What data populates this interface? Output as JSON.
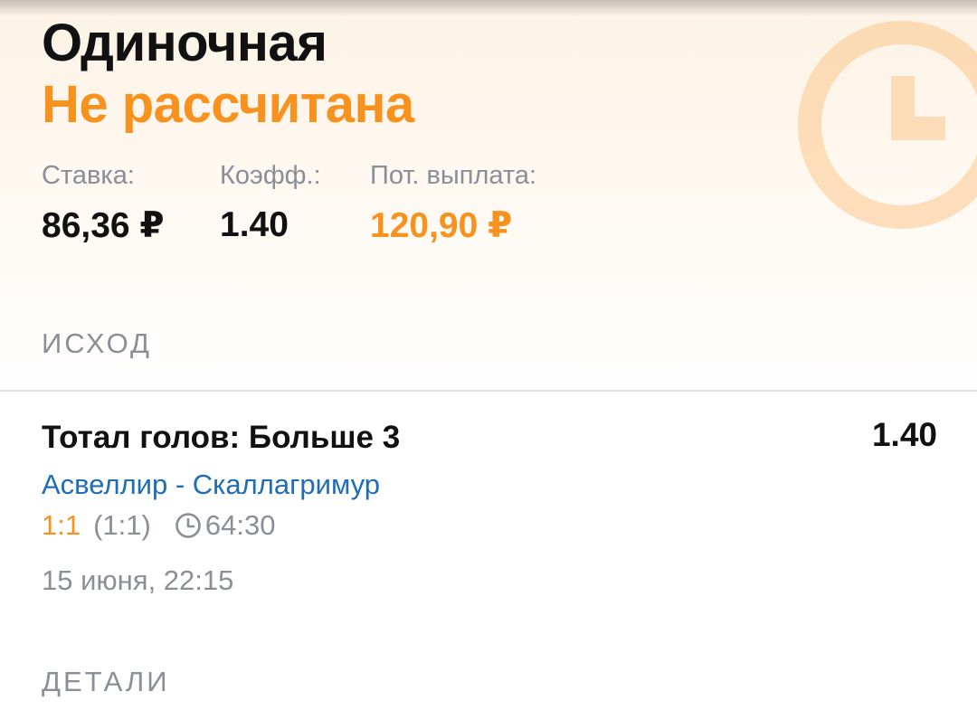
{
  "bet": {
    "type": "Одиночная",
    "status": "Не рассчитана",
    "stake_label": "Ставка:",
    "stake_value": "86,36 ₽",
    "coef_label": "Коэфф.:",
    "coef_value": "1.40",
    "payout_label": "Пот. выплата:",
    "payout_value": "120,90 ₽"
  },
  "sections": {
    "outcome_title": "ИСХОД",
    "details_title": "ДЕТАЛИ"
  },
  "outcome": {
    "name": "Тотал голов: Больше 3",
    "coef": "1.40",
    "match": "Асвеллир - Скаллагримур",
    "score_current": "1:1",
    "score_half": "(1:1)",
    "match_time": "64:30",
    "date": "15 июня, 22:15"
  },
  "icons": {
    "status": "clock-icon",
    "match_time": "clock-icon"
  },
  "colors": {
    "accent": "#f7921e",
    "link": "#1f6db7",
    "muted": "#8b8e96",
    "text": "#111111"
  }
}
